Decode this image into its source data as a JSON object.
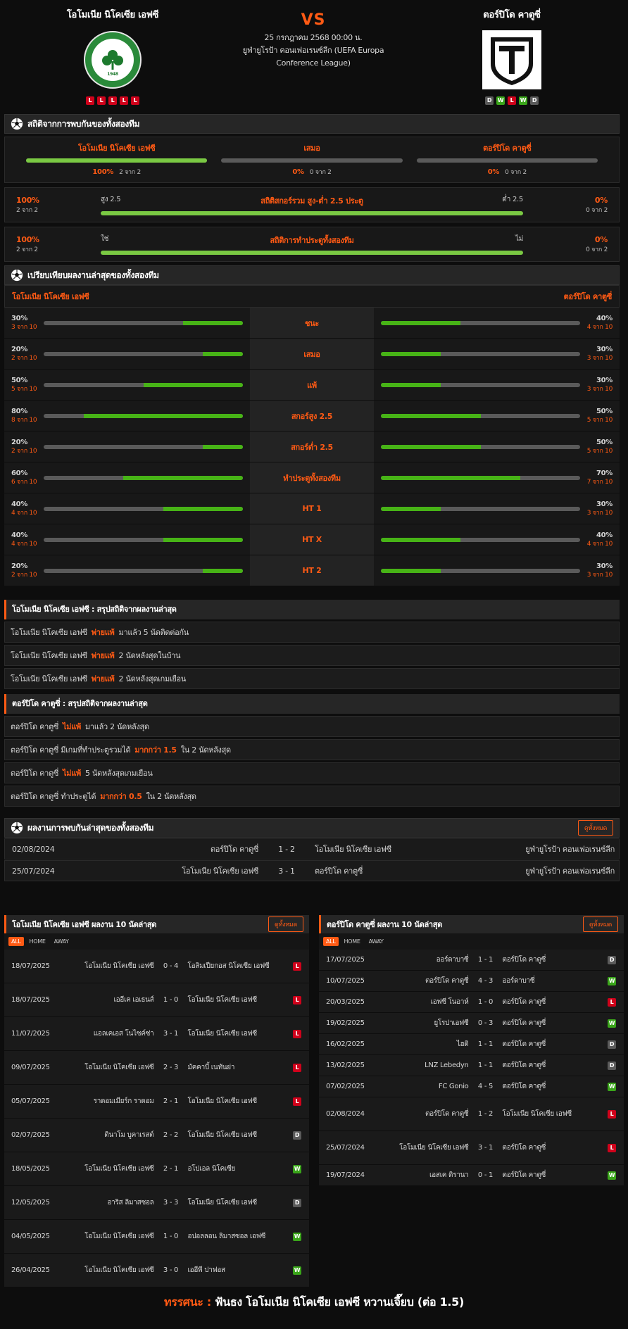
{
  "header": {
    "home_name": "โอโมเนีย นิโคเซีย เอฟซี",
    "away_name": "ตอร์ปิโด คาตูซี่",
    "vs": "VS",
    "date": "25 กรกฎาคม 2568 00:00 น.",
    "competition": "ยูฟ่ายูโรป้า คอนเฟอเรนซ์ลีก (UEFA Europa Conference League)",
    "home_logo_text": "1948",
    "home_form": [
      "L",
      "L",
      "L",
      "L",
      "L"
    ],
    "away_form": [
      "D",
      "W",
      "L",
      "W",
      "D"
    ]
  },
  "colors": {
    "accent": "#ff5a14",
    "green": "#5cc31d",
    "loss": "#d0021b",
    "win": "#3aa51a",
    "draw": "#5a5a5a"
  },
  "h2h": {
    "title": "สถิติจากการพบกันของทั้งสองทีม",
    "cols": [
      {
        "label": "โอโมเนีย นิโคเซีย เอฟซี",
        "pct": "100%",
        "of": "2 จาก 2",
        "fill": 1.0
      },
      {
        "label": "เสมอ",
        "pct": "0%",
        "of": "0 จาก 2",
        "fill": 0
      },
      {
        "label": "ตอร์ปิโด คาตูซี่",
        "pct": "0%",
        "of": "0 จาก 2",
        "fill": 0
      }
    ],
    "ou": {
      "title": "สถิติสกอร์รวม สูง-ต่ำ 2.5 ประตู",
      "left_label": "สูง 2.5",
      "right_label": "ต่ำ 2.5",
      "l_pct": "100%",
      "l_of": "2 จาก 2",
      "r_pct": "0%",
      "r_of": "0 จาก 2"
    },
    "btts": {
      "title": "สถิติการทำประตูทั้งสองทีม",
      "left_label": "ใช่",
      "right_label": "ไม่",
      "l_pct": "100%",
      "l_of": "2 จาก 2",
      "r_pct": "0%",
      "r_of": "0 จาก 2"
    }
  },
  "compare": {
    "title": "เปรียบเทียบผลงานล่าสุดของทั้งสองทีม",
    "home": "โอโมเนีย นิโคเซีย เอฟซี",
    "away": "ตอร์ปิโด คาตูซี่",
    "rows": [
      {
        "label": "ชนะ",
        "hp": "30%",
        "hc": "3 จาก 10",
        "hv": 0.3,
        "ap": "40%",
        "ac": "4 จาก 10",
        "av": 0.4
      },
      {
        "label": "เสมอ",
        "hp": "20%",
        "hc": "2 จาก 10",
        "hv": 0.2,
        "ap": "30%",
        "ac": "3 จาก 10",
        "av": 0.3
      },
      {
        "label": "แพ้",
        "hp": "50%",
        "hc": "5 จาก 10",
        "hv": 0.5,
        "ap": "30%",
        "ac": "3 จาก 10",
        "av": 0.3
      },
      {
        "label": "สกอร์สูง 2.5",
        "hp": "80%",
        "hc": "8 จาก 10",
        "hv": 0.8,
        "ap": "50%",
        "ac": "5 จาก 10",
        "av": 0.5
      },
      {
        "label": "สกอร์ต่ำ 2.5",
        "hp": "20%",
        "hc": "2 จาก 10",
        "hv": 0.2,
        "ap": "50%",
        "ac": "5 จาก 10",
        "av": 0.5
      },
      {
        "label": "ทำประตูทั้งสองทีม",
        "hp": "60%",
        "hc": "6 จาก 10",
        "hv": 0.6,
        "ap": "70%",
        "ac": "7 จาก 10",
        "av": 0.7
      },
      {
        "label": "HT 1",
        "hp": "40%",
        "hc": "4 จาก 10",
        "hv": 0.4,
        "ap": "30%",
        "ac": "3 จาก 10",
        "av": 0.3
      },
      {
        "label": "HT X",
        "hp": "40%",
        "hc": "4 จาก 10",
        "hv": 0.4,
        "ap": "40%",
        "ac": "4 จาก 10",
        "av": 0.4
      },
      {
        "label": "HT 2",
        "hp": "20%",
        "hc": "2 จาก 10",
        "hv": 0.2,
        "ap": "30%",
        "ac": "3 จาก 10",
        "av": 0.3
      }
    ]
  },
  "summary_home": {
    "title": "โอโมเนีย นิโคเซีย เอฟซี : สรุปสถิติจากผลงานล่าสุด",
    "rows": [
      {
        "a": "โอโมเนีย นิโคเซีย เอฟซี",
        "b": "พ่ายแพ้",
        "c": "มาแล้ว 5 นัดติดต่อกัน"
      },
      {
        "a": "โอโมเนีย นิโคเซีย เอฟซี",
        "b": "พ่ายแพ้",
        "c": "2 นัดหลังสุดในบ้าน"
      },
      {
        "a": "โอโมเนีย นิโคเซีย เอฟซี",
        "b": "พ่ายแพ้",
        "c": "2 นัดหลังสุดเกมเยือน"
      }
    ]
  },
  "summary_away": {
    "title": "ตอร์ปิโด คาตูซี่ : สรุปสถิติจากผลงานล่าสุด",
    "rows": [
      {
        "a": "ตอร์ปิโด คาตูซี่",
        "b": "ไม่แพ้",
        "c": "มาแล้ว 2 นัดหลังสุด"
      },
      {
        "a": "ตอร์ปิโด คาตูซี่ มีเกมที่ทำประตูรวมได้",
        "b": "มากกว่า 1.5",
        "c": "ใน 2 นัดหลังสุด"
      },
      {
        "a": "ตอร์ปิโด คาตูซี่",
        "b": "ไม่แพ้",
        "c": "5 นัดหลังสุดเกมเยือน"
      },
      {
        "a": "ตอร์ปิโด คาตูซี่ ทำประตูได้",
        "b": "มากกว่า 0.5",
        "c": "ใน 2 นัดหลังสุด"
      }
    ]
  },
  "recent_h2h": {
    "title": "ผลงานการพบกันล่าสุดของทั้งสองทีม",
    "btn": "ดูทั้งหมด",
    "rows": [
      {
        "date": "02/08/2024",
        "home": "ตอร์ปิโด คาตูซี่",
        "score": "1 - 2",
        "away": "โอโมเนีย นิโคเซีย เอฟซี",
        "comp": "ยูฟ่ายูโรป้า คอนเฟอเรนซ์ลีก"
      },
      {
        "date": "25/07/2024",
        "home": "โอโมเนีย นิโคเซีย เอฟซี",
        "score": "3 - 1",
        "away": "ตอร์ปิโด คาตูซี่",
        "comp": "ยูฟ่ายูโรป้า คอนเฟอเรนซ์ลีก"
      }
    ]
  },
  "tabs": [
    "ALL",
    "HOME",
    "AWAY"
  ],
  "home_last10": {
    "title": "โอโมเนีย นิโคเซีย เอฟซี ผลงาน 10 นัดล่าสุด",
    "btn": "ดูทั้งหมด",
    "rows": [
      {
        "date": "18/07/2025",
        "home": "โอโมเนีย นิโคเซีย เอฟซี",
        "score": "0 - 4",
        "away": "โอลิมเปียกอส นิโคเซีย เอฟซี",
        "res": "L"
      },
      {
        "date": "18/07/2025",
        "home": "เออีเค เอเธนส์",
        "score": "1 - 0",
        "away": "โอโมเนีย นิโคเซีย เอฟซี",
        "res": "L"
      },
      {
        "date": "11/07/2025",
        "home": "แอลเคเอส โนไซค์ซ่า",
        "score": "3 - 1",
        "away": "โอโมเนีย นิโคเซีย เอฟซี",
        "res": "L"
      },
      {
        "date": "09/07/2025",
        "home": "โอโมเนีย นิโคเซีย เอฟซี",
        "score": "2 - 3",
        "away": "มัคคาบี้ เนทันย่า",
        "res": "L"
      },
      {
        "date": "05/07/2025",
        "home": "ราดอมเมียร์ก ราดอม",
        "score": "2 - 1",
        "away": "โอโมเนีย นิโคเซีย เอฟซี",
        "res": "L"
      },
      {
        "date": "02/07/2025",
        "home": "ดินาโม บูคาเรสต์",
        "score": "2 - 2",
        "away": "โอโมเนีย นิโคเซีย เอฟซี",
        "res": "D"
      },
      {
        "date": "18/05/2025",
        "home": "โอโมเนีย นิโคเซีย เอฟซี",
        "score": "2 - 1",
        "away": "อโปเอล นิโคเซีย",
        "res": "W"
      },
      {
        "date": "12/05/2025",
        "home": "อาริส ลิมาสซอล",
        "score": "3 - 3",
        "away": "โอโมเนีย นิโคเซีย เอฟซี",
        "res": "D"
      },
      {
        "date": "04/05/2025",
        "home": "โอโมเนีย นิโคเซีย เอฟซี",
        "score": "1 - 0",
        "away": "อปอลลอน ลิมาสซอล เอฟซี",
        "res": "W"
      },
      {
        "date": "26/04/2025",
        "home": "โอโมเนีย นิโคเซีย เอฟซี",
        "score": "3 - 0",
        "away": "เออีพี ปาฟอส",
        "res": "W"
      }
    ]
  },
  "away_last10": {
    "title": "ตอร์ปิโด คาตูซี่ ผลงาน 10 นัดล่าสุด",
    "btn": "ดูทั้งหมด",
    "rows": [
      {
        "date": "17/07/2025",
        "home": "ออร์ดาบาซี่",
        "score": "1 - 1",
        "away": "ตอร์ปิโด คาตูซี่",
        "res": "D"
      },
      {
        "date": "10/07/2025",
        "home": "ตอร์ปิโด คาตูซี่",
        "score": "4 - 3",
        "away": "ออร์ดาบาซี่",
        "res": "W"
      },
      {
        "date": "20/03/2025",
        "home": "เอฟซี โนอาห์",
        "score": "1 - 0",
        "away": "ตอร์ปิโด คาตูซี่",
        "res": "L"
      },
      {
        "date": "19/02/2025",
        "home": "ยูโรปาเอฟซี",
        "score": "0 - 3",
        "away": "ตอร์ปิโด คาตูซี่",
        "res": "W"
      },
      {
        "date": "16/02/2025",
        "home": "ไฮดิ",
        "score": "1 - 1",
        "away": "ตอร์ปิโด คาตูซี่",
        "res": "D"
      },
      {
        "date": "13/02/2025",
        "home": "LNZ Lebedyn",
        "score": "1 - 1",
        "away": "ตอร์ปิโด คาตูซี่",
        "res": "D"
      },
      {
        "date": "07/02/2025",
        "home": "FC Gonio",
        "score": "4 - 5",
        "away": "ตอร์ปิโด คาตูซี่",
        "res": "W"
      },
      {
        "date": "02/08/2024",
        "home": "ตอร์ปิโด คาตูซี่",
        "score": "1 - 2",
        "away": "โอโมเนีย นิโคเซีย เอฟซี",
        "res": "L"
      },
      {
        "date": "25/07/2024",
        "home": "โอโมเนีย นิโคเซีย เอฟซี",
        "score": "3 - 1",
        "away": "ตอร์ปิโด คาตูซี่",
        "res": "L"
      },
      {
        "date": "19/07/2024",
        "home": "เอสเค ดิรานา",
        "score": "0 - 1",
        "away": "ตอร์ปิโด คาตูซี่",
        "res": "W"
      }
    ]
  },
  "verdict": {
    "label": "ทรรศนะ :",
    "text": "ฟันธง โอโมเนีย นิโคเซีย เอฟซี หวานเจี๊ยบ (ต่อ 1.5)"
  }
}
